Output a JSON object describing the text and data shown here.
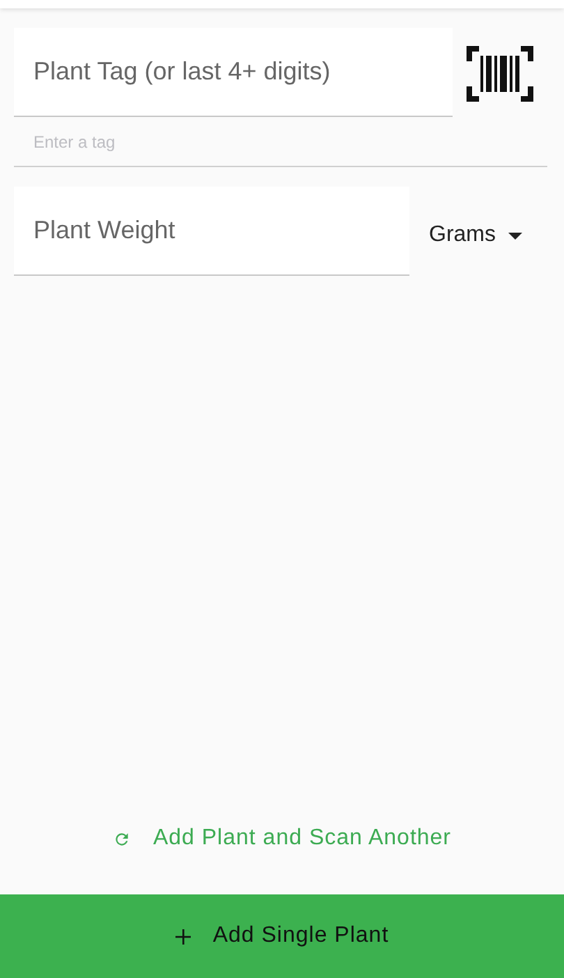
{
  "tag_field": {
    "placeholder": "Plant Tag (or last 4+ digits)"
  },
  "tag_entry": {
    "placeholder": "Enter a tag"
  },
  "weight_field": {
    "placeholder": "Plant Weight"
  },
  "unit_dropdown": {
    "value": "Grams"
  },
  "scan_another_button": {
    "label": "Add Plant and Scan Another"
  },
  "add_single_button": {
    "label": "Add Single Plant"
  }
}
